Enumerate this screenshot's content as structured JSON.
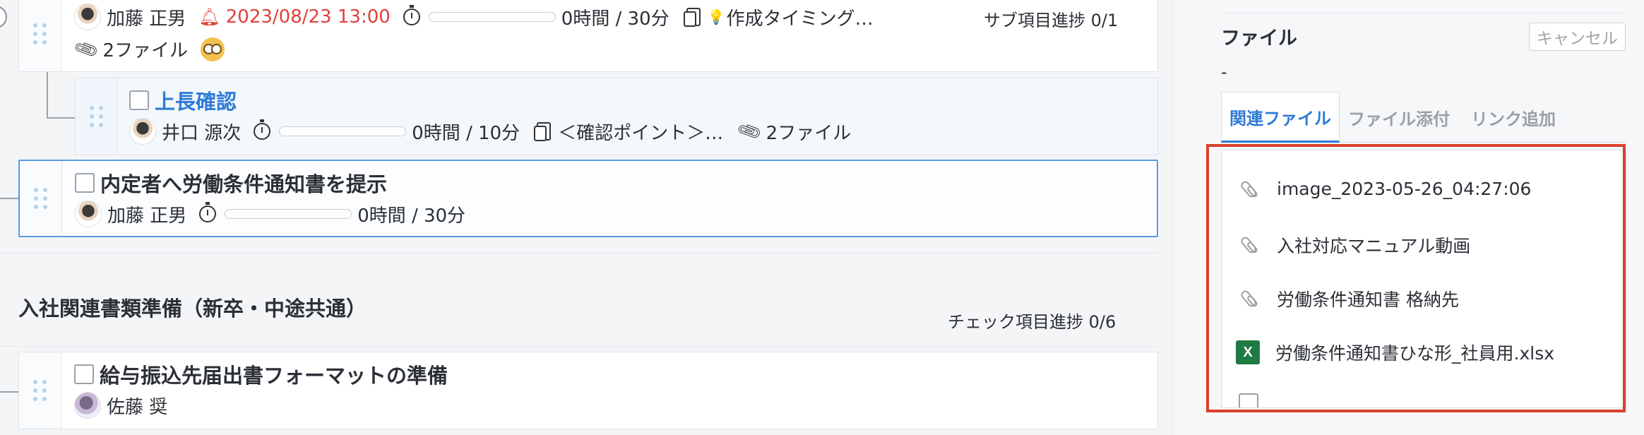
{
  "tasks": {
    "top": {
      "assignee": "加藤 正男",
      "due": "2023/08/23 13:00",
      "time": "0時間 / 30分",
      "memo": "作成タイミング…",
      "files": "2ファイル",
      "sub_progress": "サブ項目進捗 0/1"
    },
    "child": {
      "title": "上長確認",
      "assignee": "井口 源次",
      "time": "0時間 / 10分",
      "memo": "＜確認ポイント＞…",
      "files": "2ファイル"
    },
    "selected": {
      "title": "内定者へ労働条件通知書を提示",
      "assignee": "加藤 正男",
      "time": "0時間 / 30分"
    }
  },
  "section": {
    "title": "入社関連書類準備（新卒・中途共通）",
    "progress": "チェック項目進捗 0/6",
    "task": {
      "title": "給与振込先届出書フォーマットの準備",
      "assignee": "佐藤 奨"
    }
  },
  "panel": {
    "title": "ファイル",
    "cancel_label": "キャンセル",
    "value": "-",
    "tabs": [
      "関連ファイル",
      "ファイル添付",
      "リンク追加"
    ],
    "active_tab": "関連ファイル",
    "files": [
      {
        "name": "image_2023-05-26_04:27:06",
        "icon": "link-icon"
      },
      {
        "name": "入社対応マニュアル動画",
        "icon": "link-icon"
      },
      {
        "name": "労働条件通知書 格納先",
        "icon": "link-icon"
      },
      {
        "name": "労働条件通知書ひな形_社員用.xlsx",
        "icon": "excel-icon"
      }
    ]
  },
  "colors": {
    "accent": "#2f7ad6",
    "due_red": "#e0403a",
    "highlight_red": "#d9412b",
    "excel_green": "#1f7a44"
  }
}
